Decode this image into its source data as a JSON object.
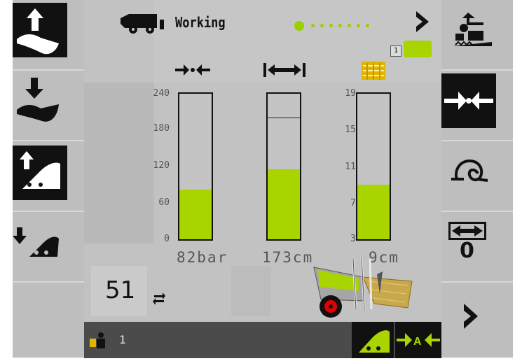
{
  "header": {
    "status_text": "Working",
    "page_dots": [
      true,
      false,
      false,
      false,
      false,
      false,
      false,
      false
    ],
    "mini_badge": "1"
  },
  "gauges": [
    {
      "id": "pressure",
      "ticks": [
        "240",
        "180",
        "120",
        "60",
        "0"
      ],
      "min": 0,
      "max": 240,
      "value": 82,
      "readout": "82bar",
      "color": "#a8d400"
    },
    {
      "id": "length",
      "ticks": [],
      "fill_fraction": 0.48,
      "marker_fraction": 0.83,
      "readout": "173cm",
      "color": "#a8d400"
    },
    {
      "id": "moisture",
      "ticks": [
        "19",
        "15",
        "11",
        "7",
        "3"
      ],
      "min": 3,
      "max": 19,
      "value": 9,
      "readout": "9cm",
      "color": "#a8d400"
    }
  ],
  "bale_counter": {
    "value": "51",
    "icon": "swap-arrows-icon"
  },
  "status_bar": {
    "operator_count": "1"
  },
  "left_buttons": [
    {
      "name": "raise-pickup-button",
      "icon": "pickup-up-icon"
    },
    {
      "name": "lower-pickup-button",
      "icon": "pickup-down-icon"
    },
    {
      "name": "open-tailgate-button",
      "icon": "tailgate-up-icon"
    },
    {
      "name": "close-tailgate-button",
      "icon": "tailgate-down-icon"
    },
    {
      "name": "empty-left-button",
      "icon": ""
    }
  ],
  "right_buttons": [
    {
      "name": "unload-bale-button",
      "icon": "bale-eject-icon"
    },
    {
      "name": "compression-button",
      "icon": "compress-icon"
    },
    {
      "name": "knotter-button",
      "icon": "knotter-icon"
    },
    {
      "name": "offset-button",
      "icon": "width-arrows-icon",
      "value": "0"
    },
    {
      "name": "next-page-button",
      "icon": "chevron-right-icon"
    }
  ],
  "colors": {
    "accent": "#a8d400",
    "panel": "#c2c2c2",
    "dark": "#111111"
  }
}
